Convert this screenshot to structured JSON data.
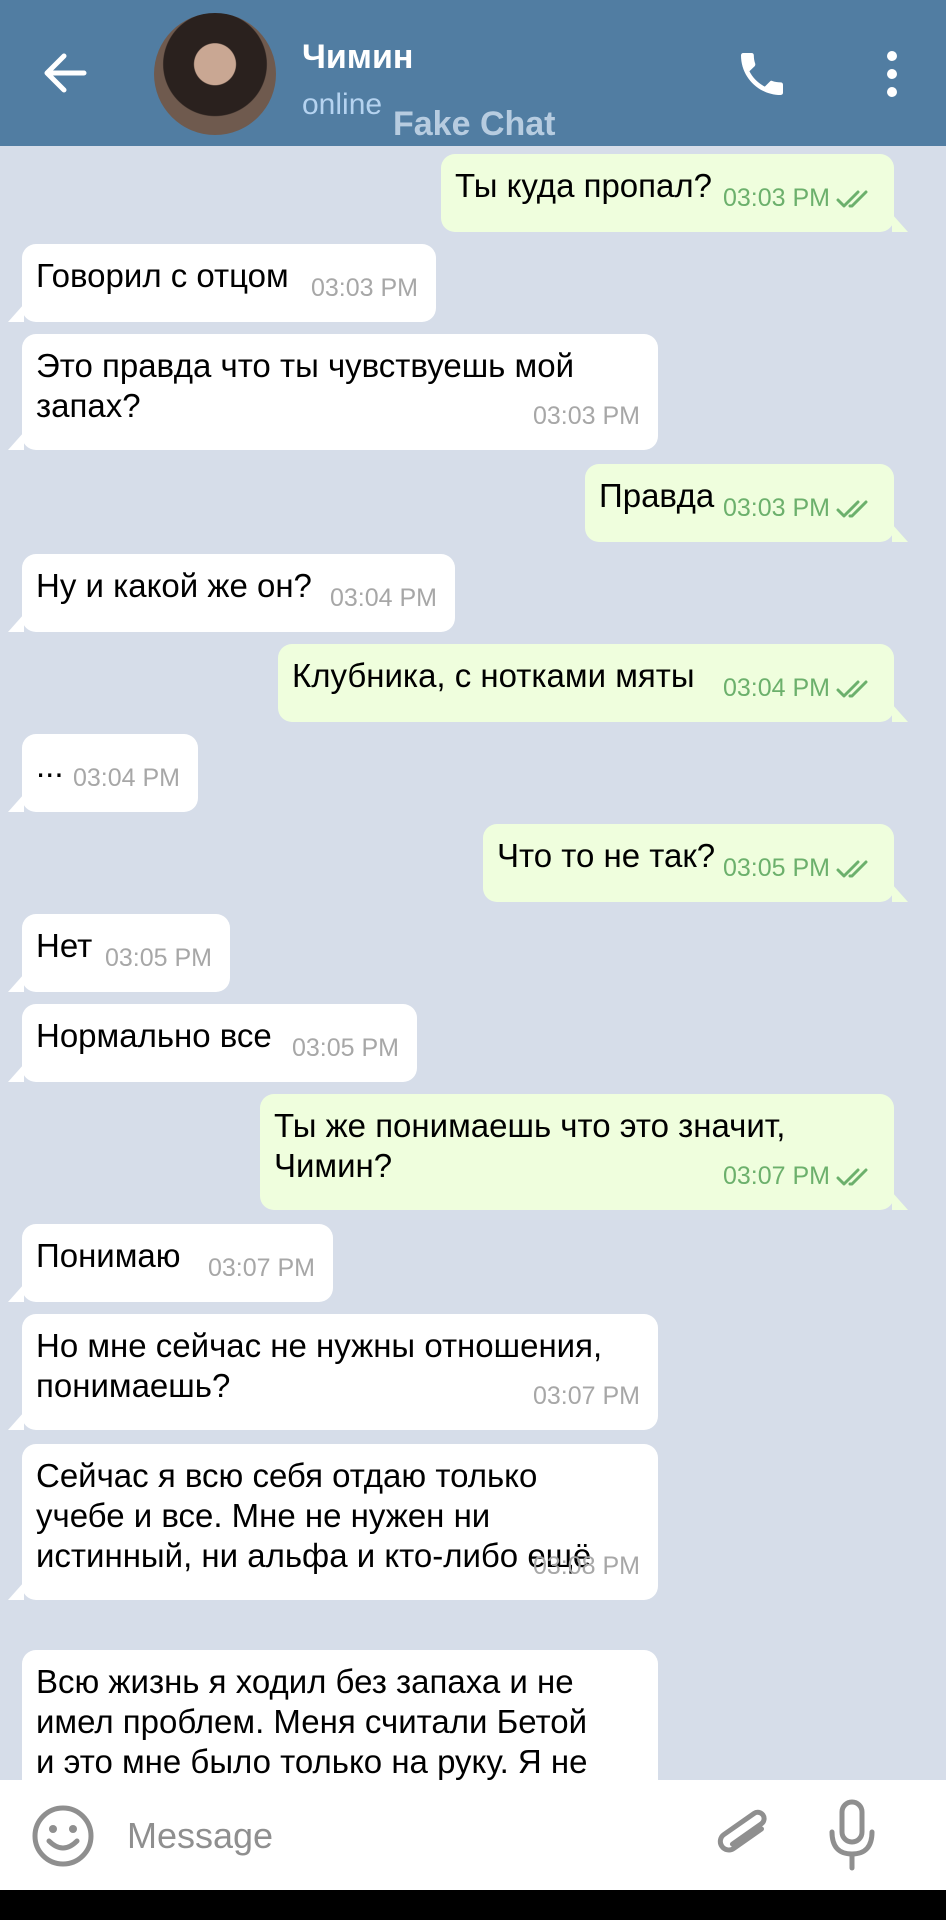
{
  "header": {
    "contact_name": "Чимин",
    "status": "online",
    "watermark": "Fake Chat"
  },
  "messages": [
    {
      "dir": "out",
      "lines": [
        "Ты куда пропал?"
      ],
      "time": "03:03 PM"
    },
    {
      "dir": "in",
      "lines": [
        "Говорил с отцом"
      ],
      "time": "03:03 PM"
    },
    {
      "dir": "in",
      "lines": [
        "Это правда что ты чувствуешь мой",
        "запах?"
      ],
      "time": "03:03 PM"
    },
    {
      "dir": "out",
      "lines": [
        "Правда"
      ],
      "time": "03:03 PM"
    },
    {
      "dir": "in",
      "lines": [
        "Ну и какой же он?"
      ],
      "time": "03:04 PM"
    },
    {
      "dir": "out",
      "lines": [
        "Клубника, с нотками мяты"
      ],
      "time": "03:04 PM"
    },
    {
      "dir": "in",
      "lines": [
        "..."
      ],
      "time": "03:04 PM"
    },
    {
      "dir": "out",
      "lines": [
        "Что то не так?"
      ],
      "time": "03:05 PM"
    },
    {
      "dir": "in",
      "lines": [
        "Нет"
      ],
      "time": "03:05 PM"
    },
    {
      "dir": "in",
      "lines": [
        "Нормально все"
      ],
      "time": "03:05 PM"
    },
    {
      "dir": "out",
      "lines": [
        "Ты же понимаешь что это значит,",
        "Чимин?"
      ],
      "time": "03:07 PM"
    },
    {
      "dir": "in",
      "lines": [
        "Понимаю"
      ],
      "time": "03:07 PM"
    },
    {
      "dir": "in",
      "lines": [
        "Но мне сейчас не нужны отношения,",
        "понимаешь?"
      ],
      "time": "03:07 PM"
    },
    {
      "dir": "in",
      "lines": [
        "Сейчас я всю себя отдаю только",
        "учебе и все. Мне не нужен ни",
        "истинный, ни альфа и кто-либо ещё"
      ],
      "time": "03:08 PM"
    },
    {
      "dir": "in",
      "lines": [
        "Всю жизнь я ходил без запаха и не",
        "имел проблем. Меня считали Бетой",
        "и это мне было только на руку. Я не"
      ],
      "time": ""
    }
  ],
  "input": {
    "placeholder": "Message",
    "value": ""
  },
  "icons": {
    "back": "arrow-left-icon",
    "call": "phone-icon",
    "menu": "more-vertical-icon",
    "emoji": "emoji-icon",
    "attach": "paperclip-icon",
    "mic": "microphone-icon"
  },
  "colors": {
    "header": "#517da2",
    "chat_background": "#d6dde9",
    "incoming_bubble": "#ffffff",
    "outgoing_bubble": "#effedd",
    "read_ticks": "#6cb06c"
  }
}
